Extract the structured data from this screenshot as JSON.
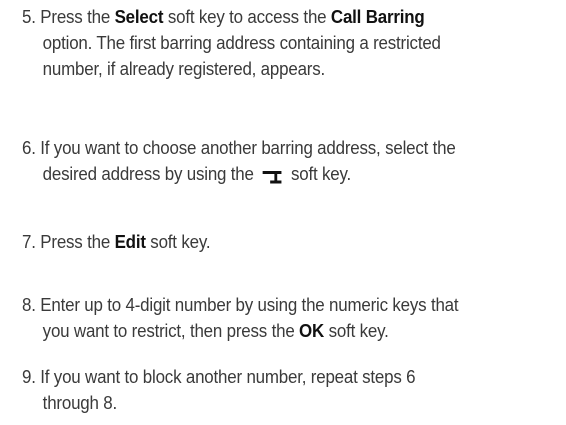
{
  "steps": [
    {
      "number": "5.",
      "line1": {
        "a": "Press the ",
        "b1": "Select",
        "c": " soft key to access the ",
        "b2": "Call Barring"
      },
      "line2": "option. The first barring address containing a restricted",
      "line3": "number, if already registered, appears."
    },
    {
      "number": "6.",
      "line1": "If you want to choose another barring address, select the",
      "line2_a": "desired address by using the ",
      "line2_icon": "down-arrow-softkey-icon",
      "line2_b": " soft key."
    },
    {
      "number": "7.",
      "a": "Press the ",
      "b": "Edit",
      "c": " soft key."
    },
    {
      "number": "8.",
      "line1": "Enter up to 4-digit number by using the numeric keys that",
      "line2_a": "you want to restrict, then press the ",
      "line2_b": "OK",
      "line2_c": " soft key."
    },
    {
      "number": "9.",
      "line1": "If you want to block another number, repeat steps 6",
      "line2": "through 8."
    }
  ],
  "colors": {
    "text": "#3a3a3a",
    "bold": "#111111",
    "background": "#ffffff"
  }
}
